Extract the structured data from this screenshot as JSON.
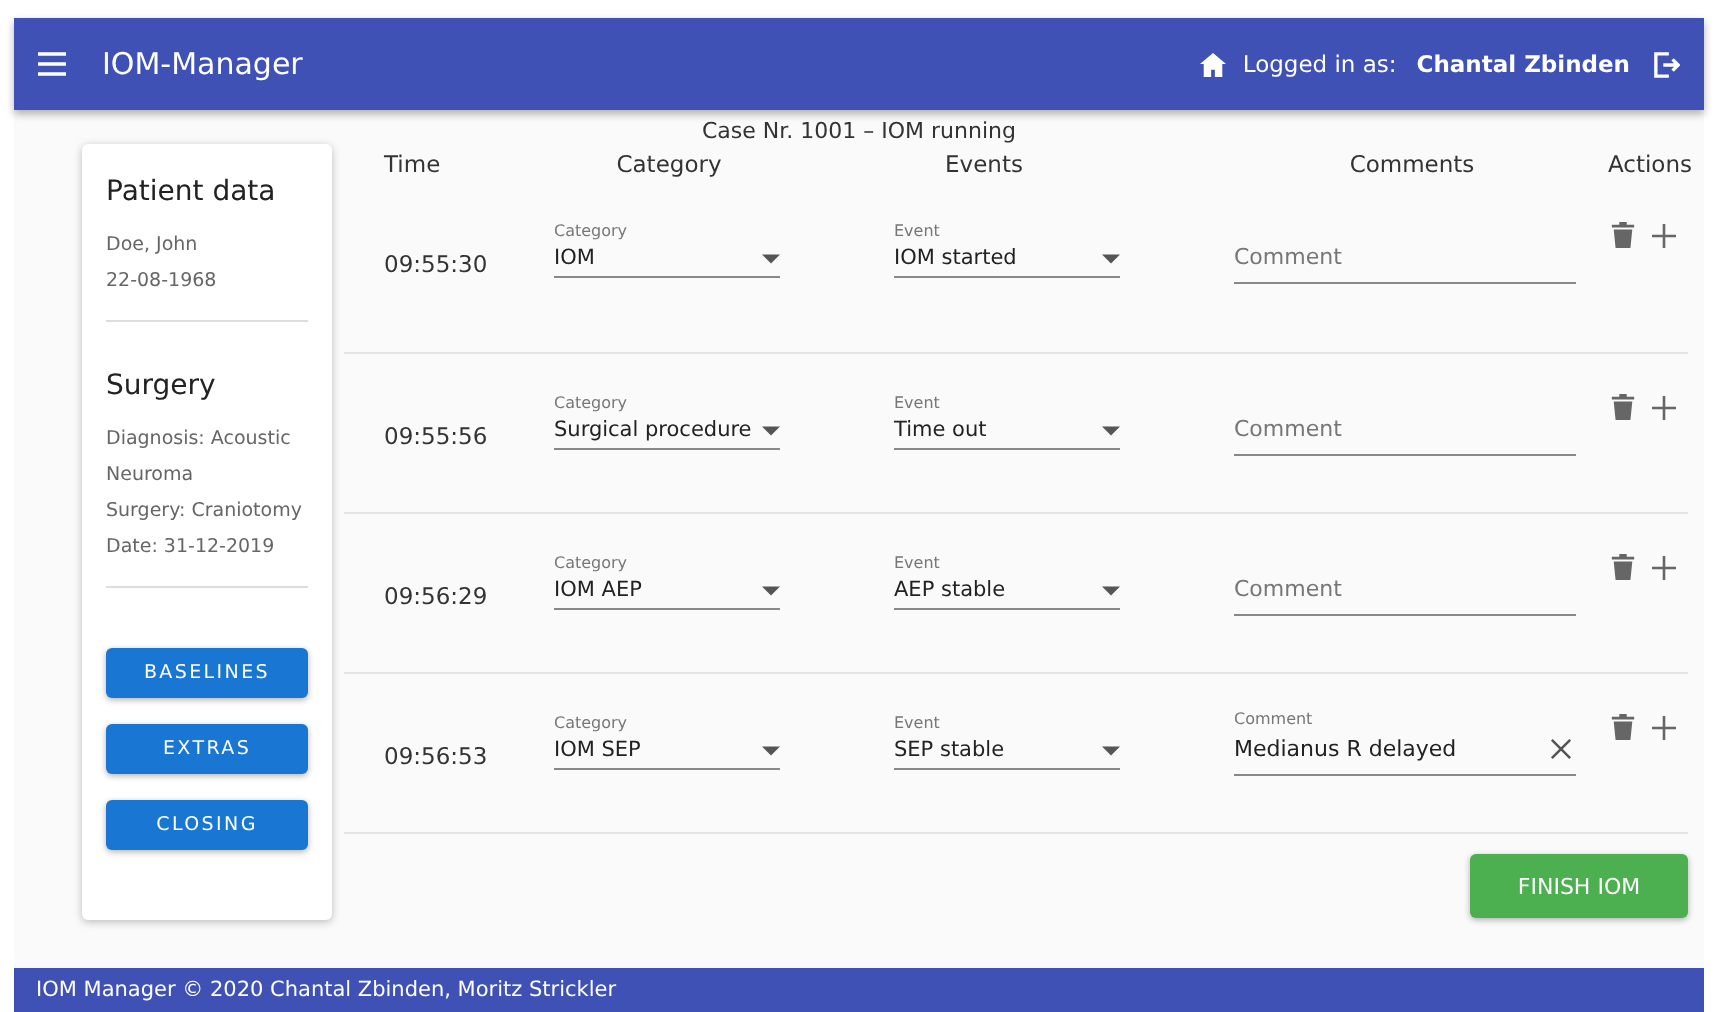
{
  "app_bar": {
    "title": "IOM-Manager",
    "logged_in_label": "Logged in as:",
    "user": "Chantal Zbinden"
  },
  "case_title": "Case Nr. 1001 – IOM running",
  "patient": {
    "heading": "Patient data",
    "lines": [
      "Doe, John",
      "22-08-1968"
    ]
  },
  "surgery": {
    "heading": "Surgery",
    "lines": [
      "Diagnosis: Acoustic Neuroma",
      "Surgery: Craniotomy",
      "Date: 31-12-2019"
    ]
  },
  "side_buttons": [
    "BASELINES",
    "EXTRAS",
    "CLOSING"
  ],
  "table": {
    "columns": [
      "Time",
      "Category",
      "Events",
      "Comments",
      "Actions"
    ],
    "rows": [
      {
        "time": "09:55:30",
        "category": {
          "label": "Category",
          "value": "IOM"
        },
        "event": {
          "label": "Event",
          "value": "IOM started"
        },
        "comment": {
          "placeholder": "Comment"
        }
      },
      {
        "time": "09:55:56",
        "category": {
          "label": "Category",
          "value": "Surgical procedure"
        },
        "event": {
          "label": "Event",
          "value": "Time out"
        },
        "comment": {
          "placeholder": "Comment"
        }
      },
      {
        "time": "09:56:29",
        "category": {
          "label": "Category",
          "value": "IOM AEP"
        },
        "event": {
          "label": "Event",
          "value": "AEP stable"
        },
        "comment": {
          "placeholder": "Comment"
        }
      },
      {
        "time": "09:56:53",
        "category": {
          "label": "Category",
          "value": "IOM SEP"
        },
        "event": {
          "label": "Event",
          "value": "SEP stable"
        },
        "comment": {
          "label": "Comment",
          "value": "Medianus R delayed"
        }
      }
    ]
  },
  "finish_button": "FINISH IOM",
  "footer": "IOM Manager © 2020 Chantal Zbinden, Moritz Strickler"
}
